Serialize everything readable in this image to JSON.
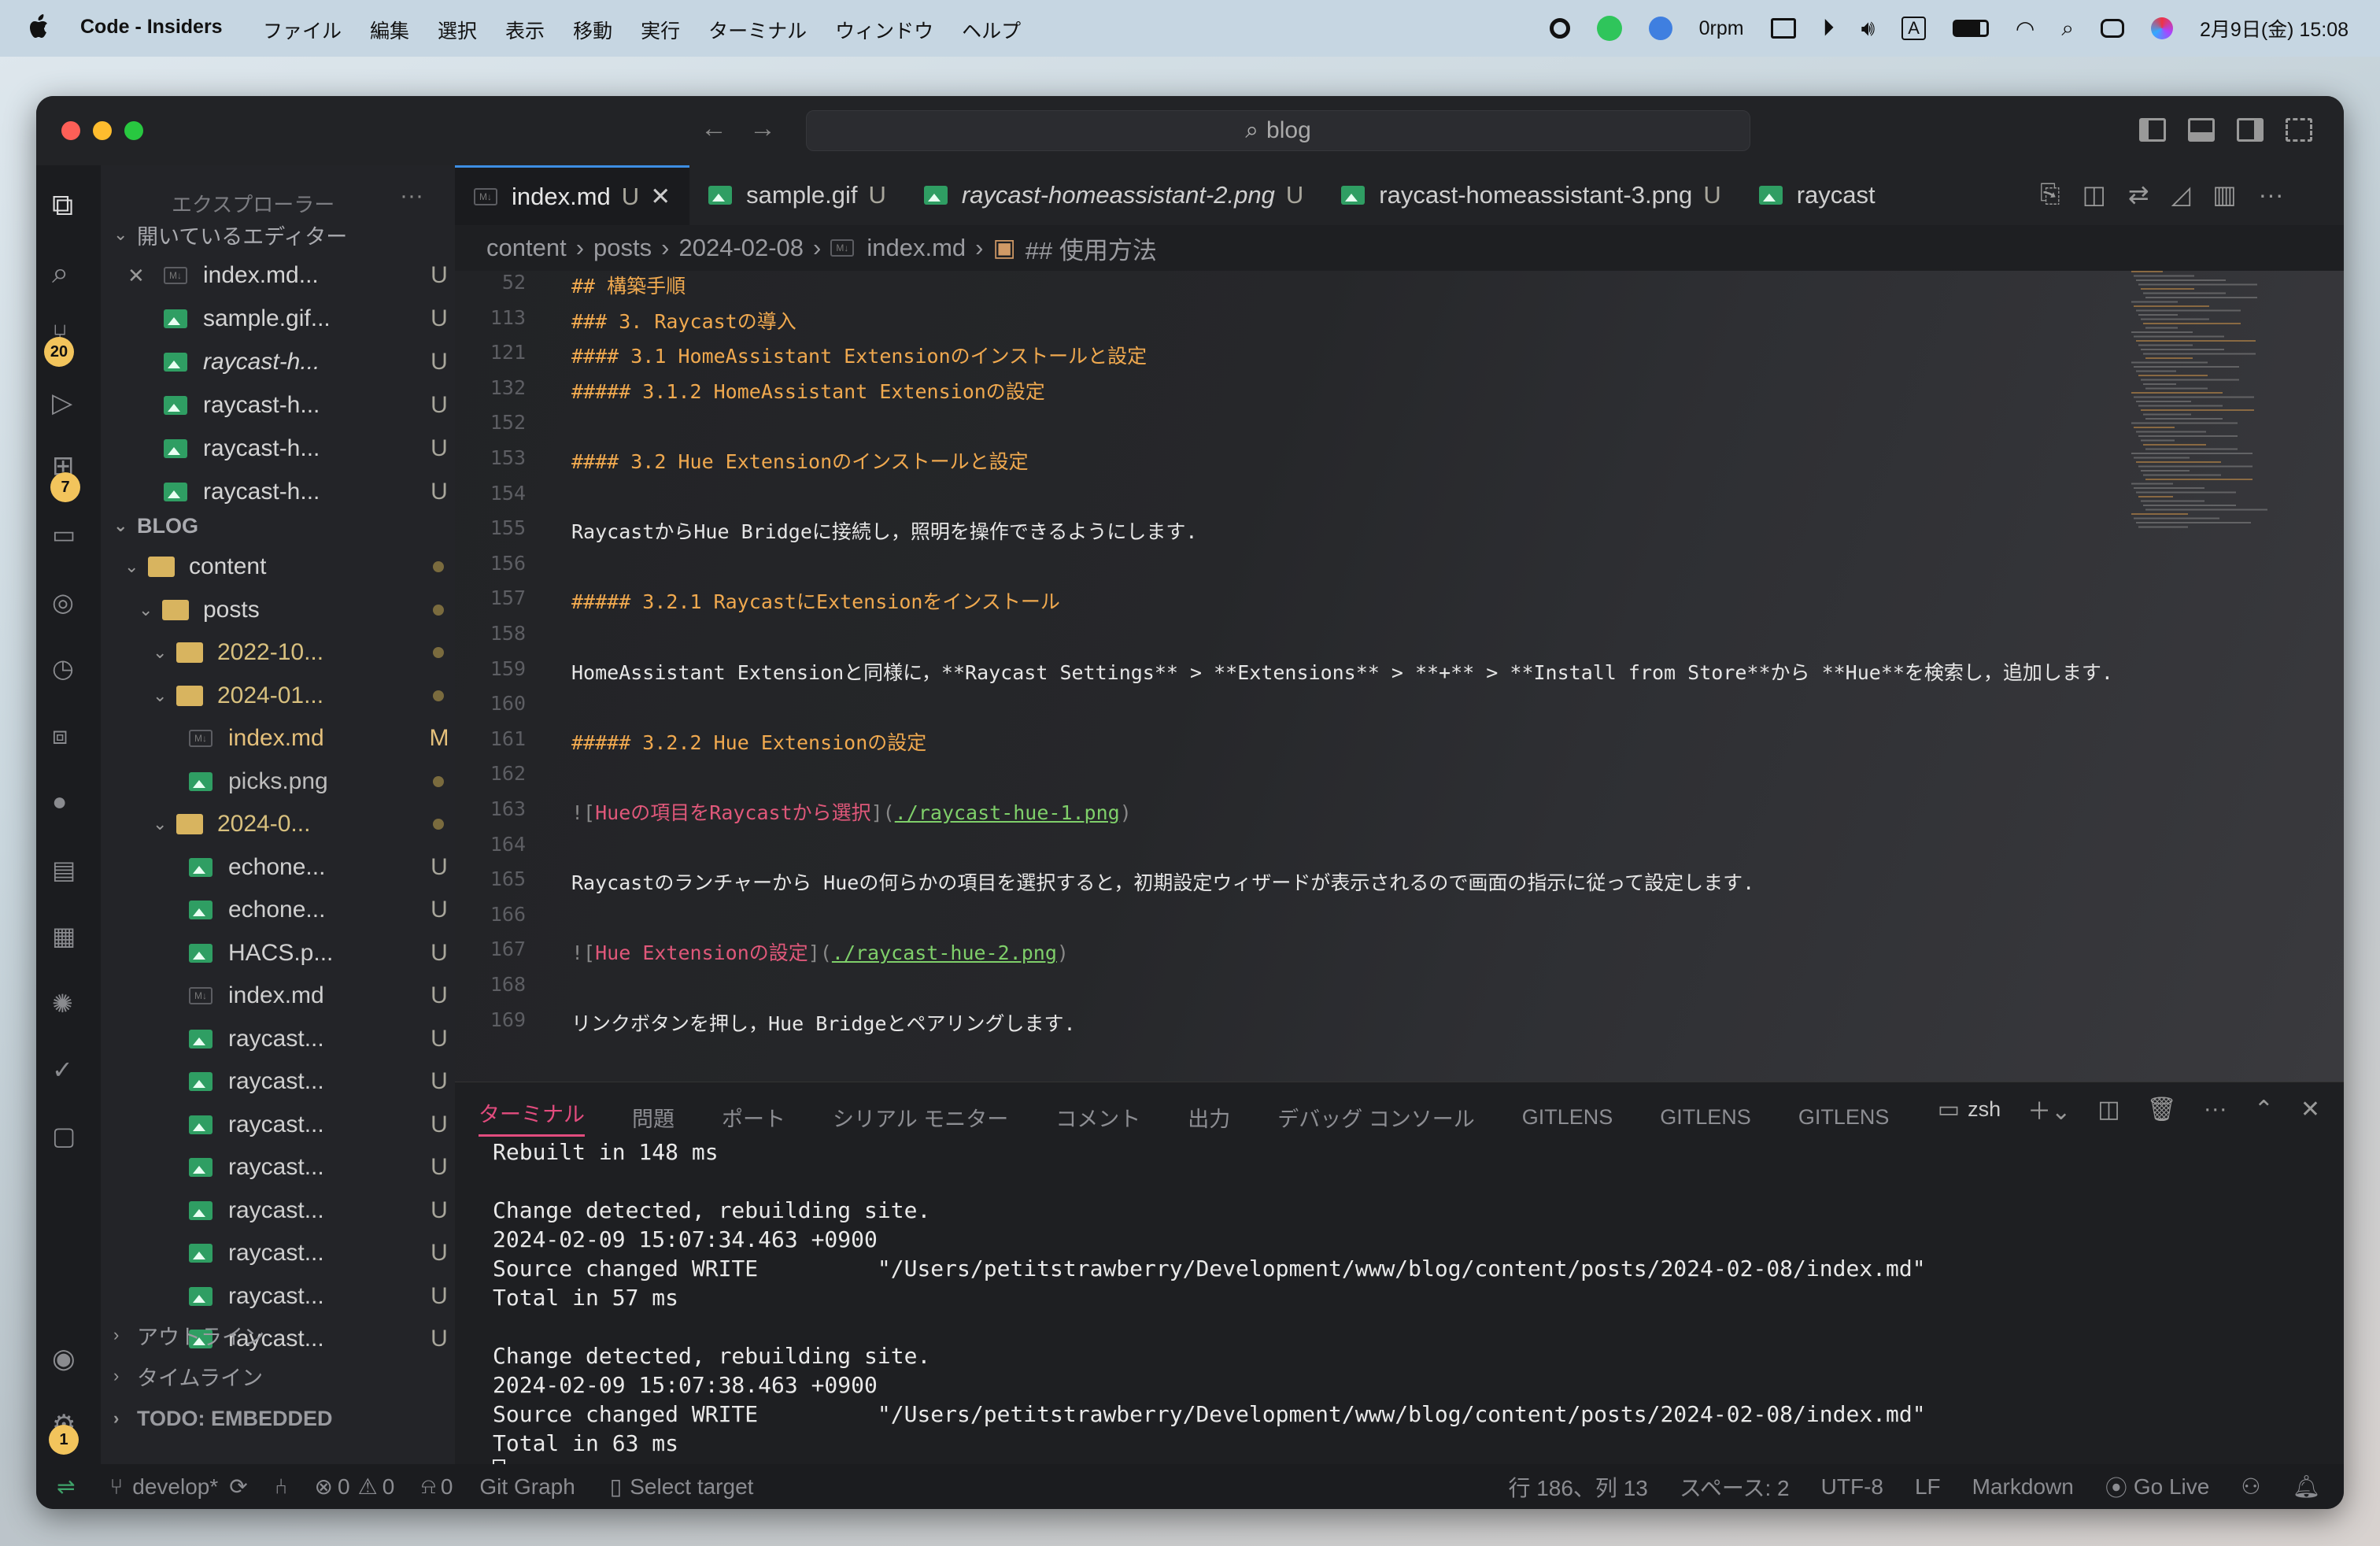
{
  "menubar": {
    "app_name": "Code - Insiders",
    "menus": [
      "ファイル",
      "編集",
      "選択",
      "表示",
      "移動",
      "実行",
      "ターミナル",
      "ウィンドウ",
      "ヘルプ"
    ],
    "rpm": "0rpm",
    "input_mode": "A",
    "datetime": "2月9日(金) 15:08"
  },
  "window": {
    "search_text": "blog"
  },
  "activity": {
    "scm_badge": "20",
    "ext_badge": "7",
    "settings_badge": "1"
  },
  "sidebar": {
    "title": "エクスプローラー",
    "open_editors_label": "開いているエディター",
    "open_editors": [
      {
        "name": "index.md...",
        "status": "U",
        "type": "md"
      },
      {
        "name": "sample.gif...",
        "status": "U",
        "type": "img"
      },
      {
        "name": "raycast-h...",
        "status": "U",
        "type": "img"
      },
      {
        "name": "raycast-h...",
        "status": "U",
        "type": "img"
      },
      {
        "name": "raycast-h...",
        "status": "U",
        "type": "img"
      },
      {
        "name": "raycast-h...",
        "status": "U",
        "type": "img"
      }
    ],
    "project_label": "BLOG",
    "tree": [
      {
        "name": "content",
        "indent": 1,
        "kind": "folder"
      },
      {
        "name": "posts",
        "indent": 2,
        "kind": "folder"
      },
      {
        "name": "2022-10...",
        "indent": 3,
        "kind": "folder"
      },
      {
        "name": "2024-01...",
        "indent": 3,
        "kind": "folder"
      },
      {
        "name": "index.md",
        "indent": 4,
        "kind": "md",
        "status": "M"
      },
      {
        "name": "picks.png",
        "indent": 4,
        "kind": "img"
      },
      {
        "name": "2024-0...",
        "indent": 3,
        "kind": "folder"
      },
      {
        "name": "echone...",
        "indent": 4,
        "kind": "img",
        "status": "U"
      },
      {
        "name": "echone...",
        "indent": 4,
        "kind": "img",
        "status": "U"
      },
      {
        "name": "HACS.p...",
        "indent": 4,
        "kind": "img",
        "status": "U"
      },
      {
        "name": "index.md",
        "indent": 4,
        "kind": "md",
        "status": "U"
      },
      {
        "name": "raycast...",
        "indent": 4,
        "kind": "img",
        "status": "U"
      },
      {
        "name": "raycast...",
        "indent": 4,
        "kind": "img",
        "status": "U"
      },
      {
        "name": "raycast...",
        "indent": 4,
        "kind": "img",
        "status": "U"
      },
      {
        "name": "raycast...",
        "indent": 4,
        "kind": "img",
        "status": "U"
      },
      {
        "name": "raycast...",
        "indent": 4,
        "kind": "img",
        "status": "U"
      },
      {
        "name": "raycast...",
        "indent": 4,
        "kind": "img",
        "status": "U"
      },
      {
        "name": "raycast...",
        "indent": 4,
        "kind": "img",
        "status": "U"
      },
      {
        "name": "raycast...",
        "indent": 4,
        "kind": "img",
        "status": "U"
      }
    ],
    "outline_label": "アウトライン",
    "timeline_label": "タイムライン",
    "todo_label": "TODO: EMBEDDED"
  },
  "tabs": [
    {
      "name": "index.md",
      "status": "U",
      "type": "md",
      "active": true
    },
    {
      "name": "sample.gif",
      "status": "U",
      "type": "img"
    },
    {
      "name": "raycast-homeassistant-2.png",
      "status": "U",
      "type": "img"
    },
    {
      "name": "raycast-homeassistant-3.png",
      "status": "U",
      "type": "img"
    },
    {
      "name": "raycast",
      "status": "",
      "type": "img"
    }
  ],
  "breadcrumb": [
    "content",
    "posts",
    "2024-02-08",
    "index.md",
    "## 使用方法"
  ],
  "code": [
    {
      "ln": "52",
      "text": "## 構築手順",
      "cls": "hd"
    },
    {
      "ln": "113",
      "text": "### 3. Raycastの導入",
      "cls": "hd"
    },
    {
      "ln": "121",
      "text": "#### 3.1 HomeAssistant Extensionのインストールと設定",
      "cls": "hd"
    },
    {
      "ln": "132",
      "text": "##### 3.1.2 HomeAssistant Extensionの設定",
      "cls": "hd"
    },
    {
      "ln": "152",
      "text": "",
      "cls": "tx"
    },
    {
      "ln": "153",
      "text": "#### 3.2 Hue Extensionのインストールと設定",
      "cls": "hd"
    },
    {
      "ln": "154",
      "text": "",
      "cls": "tx"
    },
    {
      "ln": "155",
      "text": "RaycastからHue Bridgeに接続し，照明を操作できるようにします.",
      "cls": "tx"
    },
    {
      "ln": "156",
      "text": "",
      "cls": "tx"
    },
    {
      "ln": "157",
      "text": "##### 3.2.1 RaycastにExtensionをインストール",
      "cls": "hd"
    },
    {
      "ln": "158",
      "text": "",
      "cls": "tx"
    },
    {
      "ln": "159",
      "text": "HomeAssistant Extensionと同様に，**Raycast Settings** > **Extensions** > **+** > **Install from Store**から **Hue**を検索し，追加します.",
      "cls": "tx"
    },
    {
      "ln": "160",
      "text": "",
      "cls": "tx"
    },
    {
      "ln": "161",
      "text": "##### 3.2.2 Hue Extensionの設定",
      "cls": "hd"
    },
    {
      "ln": "162",
      "text": "",
      "cls": "tx"
    },
    {
      "ln": "163",
      "text": "![Hueの項目をRaycastから選択](./raycast-hue-1.png)",
      "cls": "img",
      "alt": "Hueの項目をRaycastから選択",
      "url": "./raycast-hue-1.png"
    },
    {
      "ln": "164",
      "text": "",
      "cls": "tx"
    },
    {
      "ln": "165",
      "text": "Raycastのランチャーから Hueの何らかの項目を選択すると，初期設定ウィザードが表示されるので画面の指示に従って設定します.",
      "cls": "tx"
    },
    {
      "ln": "166",
      "text": "",
      "cls": "tx"
    },
    {
      "ln": "167",
      "text": "![Hue Extensionの設定](./raycast-hue-2.png)",
      "cls": "img",
      "alt": "Hue Extensionの設定",
      "url": "./raycast-hue-2.png"
    },
    {
      "ln": "168",
      "text": "",
      "cls": "tx"
    },
    {
      "ln": "169",
      "text": "リンクボタンを押し，Hue Bridgeとペアリングします.",
      "cls": "tx"
    }
  ],
  "panel": {
    "tabs": [
      "ターミナル",
      "問題",
      "ポート",
      "シリアル モニター",
      "コメント",
      "出力",
      "デバッグ コンソール",
      "GITLENS",
      "GITLENS",
      "GITLENS"
    ],
    "shell": "zsh",
    "terminal": [
      "Rebuilt in 148 ms",
      "",
      "Change detected, rebuilding site.",
      "2024-02-09 15:07:34.463 +0900",
      "Source changed WRITE         \"/Users/petitstrawberry/Development/www/blog/content/posts/2024-02-08/index.md\"",
      "Total in 57 ms",
      "",
      "Change detected, rebuilding site.",
      "2024-02-09 15:07:38.463 +0900",
      "Source changed WRITE         \"/Users/petitstrawberry/Development/www/blog/content/posts/2024-02-08/index.md\"",
      "Total in 63 ms"
    ]
  },
  "statusbar": {
    "branch": "develop*",
    "errors": "0",
    "warnings": "0",
    "ports": "0",
    "git_graph": "Git Graph",
    "select_target": "Select target",
    "position": "行 186、列 13",
    "spaces": "スペース: 2",
    "encoding": "UTF-8",
    "eol": "LF",
    "language": "Markdown",
    "go_live": "Go Live"
  }
}
